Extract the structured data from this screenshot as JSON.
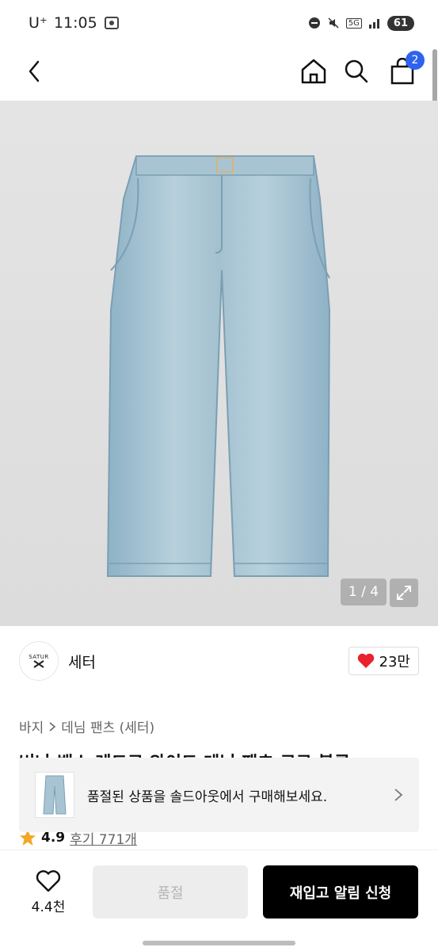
{
  "status_bar": {
    "carrier": "U⁺",
    "time": "11:05",
    "network": "5G",
    "battery": "61"
  },
  "nav": {
    "back_icon": "chevron-left-icon",
    "home_icon": "home-icon",
    "search_icon": "search-icon",
    "cart_icon": "shopping-bag-icon",
    "cart_badge": "2"
  },
  "gallery": {
    "counter": "1 / 4",
    "expand_icon": "expand-icon"
  },
  "brand": {
    "logo_text": "SATUR",
    "name": "세터",
    "likes": "23만",
    "accent": "#e8222e"
  },
  "breadcrumb": {
    "category": "바지",
    "subcategory": "데님 팬츠 (세터)"
  },
  "product": {
    "title": "버나 백스 레드로 와이드 데님 팬츠 로로 블루"
  },
  "soldout_banner": {
    "text": "품절된 상품을 솔드아웃에서 구매해보세요."
  },
  "rating": {
    "score": "4.9",
    "reviews": "후기 771개"
  },
  "bottom_bar": {
    "wish_count": "4.4천",
    "soldout_label": "품절",
    "restock_label": "재입고 알림 신청"
  },
  "colors": {
    "badge_blue": "#2f63ee",
    "cta_black": "#000000",
    "heart_red": "#e8222e"
  }
}
